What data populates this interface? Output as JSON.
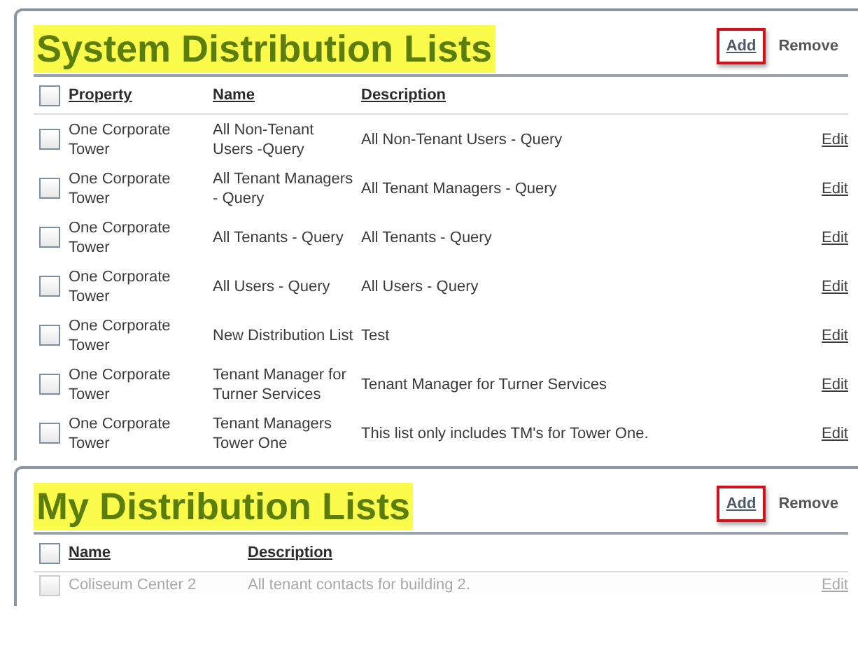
{
  "sections": [
    {
      "title": "System Distribution Lists",
      "title_highlighted": true,
      "actions": [
        {
          "label": "Add",
          "outlined": true
        },
        {
          "label": "Remove",
          "outlined": false
        }
      ],
      "header_checked": false,
      "columns": [
        "Property",
        "Name",
        "Description"
      ],
      "rows": [
        {
          "checked": false,
          "faded": false,
          "cells": [
            "One Corporate Tower",
            "All Non-Tenant Users -Query",
            "All Non-Tenant Users - Query"
          ],
          "action": "Edit"
        },
        {
          "checked": false,
          "faded": false,
          "cells": [
            "One Corporate Tower",
            "All Tenant Managers - Query",
            "All Tenant Managers - Query"
          ],
          "action": "Edit"
        },
        {
          "checked": false,
          "faded": false,
          "cells": [
            "One Corporate Tower",
            "All Tenants - Query",
            "All Tenants - Query"
          ],
          "action": "Edit"
        },
        {
          "checked": false,
          "faded": false,
          "cells": [
            "One Corporate Tower",
            "All Users - Query",
            "All Users - Query"
          ],
          "action": "Edit"
        },
        {
          "checked": false,
          "faded": false,
          "cells": [
            "One Corporate Tower",
            "New Distribution List",
            "Test"
          ],
          "action": "Edit"
        },
        {
          "checked": false,
          "faded": false,
          "cells": [
            "One Corporate Tower",
            "Tenant Manager for Turner Services",
            "Tenant Manager for Turner Services"
          ],
          "action": "Edit"
        },
        {
          "checked": false,
          "faded": false,
          "cells": [
            "One Corporate Tower",
            "Tenant Managers Tower One",
            "This list only includes TM's for Tower One."
          ],
          "action": "Edit"
        }
      ]
    },
    {
      "title": "My Distribution Lists",
      "title_highlighted": true,
      "actions": [
        {
          "label": "Add",
          "outlined": true
        },
        {
          "label": "Remove",
          "outlined": false
        }
      ],
      "header_checked": false,
      "columns": [
        "Name",
        "Description"
      ],
      "rows": [
        {
          "checked": false,
          "faded": true,
          "cells": [
            "Coliseum Center 2",
            "All tenant contacts for building 2."
          ],
          "action": "Edit"
        }
      ]
    }
  ]
}
